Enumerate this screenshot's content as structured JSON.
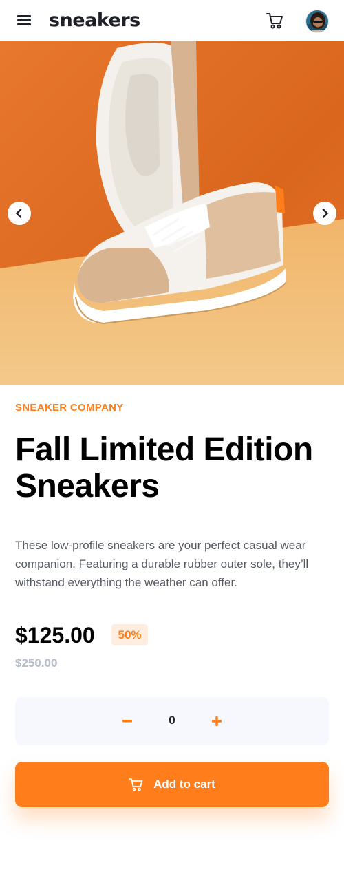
{
  "header": {
    "logo": "sneakers",
    "menu_icon": "hamburger-menu-icon",
    "cart_icon": "cart-icon",
    "avatar_icon": "user-avatar"
  },
  "gallery": {
    "prev_icon": "chevron-left-icon",
    "next_icon": "chevron-right-icon",
    "image": "sneaker-product-photo"
  },
  "product": {
    "company": "SNEAKER COMPANY",
    "title": "Fall Limited Edition Sneakers",
    "description": "These low-profile sneakers are your perfect casual wear companion. Featuring a durable rubber outer sole, they’ll withstand everything the weather can offer.",
    "price": "$125.00",
    "discount": "50%",
    "original_price": "$250.00"
  },
  "quantity": {
    "value": "0",
    "minus_icon": "minus-icon",
    "plus_icon": "plus-icon"
  },
  "add_to_cart": {
    "label": "Add to cart",
    "icon": "cart-icon"
  },
  "colors": {
    "accent": "#ff7e1b",
    "accent_pale": "#ffede0",
    "text_dark": "#1d2026",
    "text_muted": "#555a62",
    "strike_gray": "#b6bcc8",
    "qty_bg": "#f6f8fd"
  }
}
